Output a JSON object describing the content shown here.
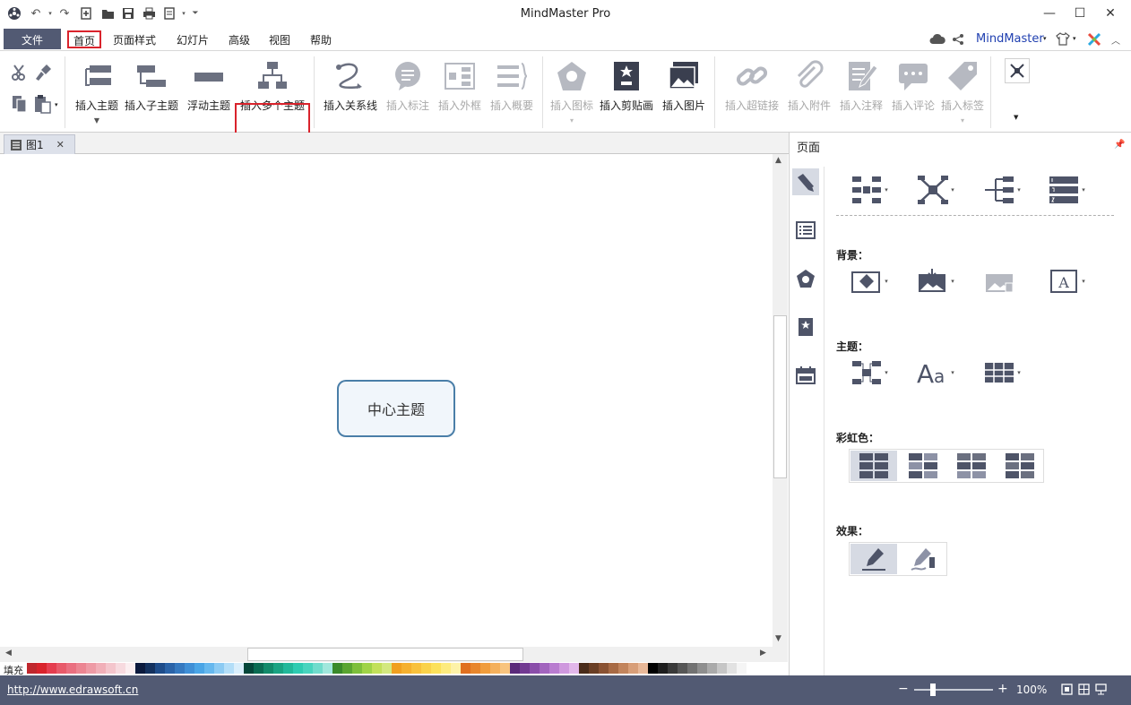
{
  "window": {
    "title": "MindMaster Pro"
  },
  "menu": {
    "file": "文件",
    "items": [
      "首页",
      "页面样式",
      "幻灯片",
      "高级",
      "视图",
      "帮助"
    ],
    "brand": "MindMaster"
  },
  "ribbon": {
    "buttons": [
      {
        "label": "插入主题"
      },
      {
        "label": "插入子主题"
      },
      {
        "label": "浮动主题"
      },
      {
        "label": "插入多个主题"
      },
      {
        "label": "插入关系线"
      },
      {
        "label": "插入标注"
      },
      {
        "label": "插入外框"
      },
      {
        "label": "插入概要"
      },
      {
        "label": "插入图标"
      },
      {
        "label": "插入剪贴画"
      },
      {
        "label": "插入图片"
      },
      {
        "label": "插入超链接"
      },
      {
        "label": "插入附件"
      },
      {
        "label": "插入注释"
      },
      {
        "label": "插入评论"
      },
      {
        "label": "插入标签"
      }
    ]
  },
  "doc_tab": {
    "label": "图1"
  },
  "canvas": {
    "central_topic": "中心主题"
  },
  "colorbar": {
    "label": "填充"
  },
  "status": {
    "url": "http://www.edrawsoft.cn",
    "zoom": "100%"
  },
  "panel": {
    "title": "页面",
    "sections": {
      "background": "背景：",
      "theme": "主题：",
      "rainbow": "彩虹色：",
      "effect": "效果："
    }
  },
  "colors": {
    "accent": "#525a73",
    "highlight": "#d9232c",
    "topic_border": "#4a7ea8",
    "swatches": [
      "#c0272d",
      "#d9232c",
      "#e53d4f",
      "#e85a6a",
      "#ea6f80",
      "#ec8592",
      "#ee9aa5",
      "#f1afb8",
      "#f4c5cc",
      "#f7dadf",
      "#fbeef0",
      "#0c1a3d",
      "#14315e",
      "#1e4c8a",
      "#2a63a8",
      "#3579c0",
      "#3f8fd6",
      "#4aa5e6",
      "#66b8ee",
      "#8ccbf3",
      "#b3def8",
      "#d9eefb",
      "#05473a",
      "#0a6b52",
      "#128a6a",
      "#1aa382",
      "#22b89a",
      "#2ecbb1",
      "#48d4be",
      "#70dccc",
      "#a0e7dc",
      "#3a8a2a",
      "#5aa531",
      "#7dbf3b",
      "#9fd347",
      "#c2e05a",
      "#d3e87f",
      "#f0a020",
      "#f5b02e",
      "#f8c13c",
      "#fad24a",
      "#fce15a",
      "#fdeb7e",
      "#fdf2a8",
      "#e07020",
      "#e8862c",
      "#f09c3c",
      "#f4b05c",
      "#f8c47e",
      "#5a2a7a",
      "#723a92",
      "#8a4eaa",
      "#a264be",
      "#b97cd0",
      "#cf98de",
      "#e2b7ea",
      "#4a2c1a",
      "#6a3e24",
      "#8a5232",
      "#a86a44",
      "#c2845c",
      "#d89e78",
      "#e8b898",
      "#000000",
      "#1e1e1e",
      "#3a3a3a",
      "#565656",
      "#727272",
      "#8e8e8e",
      "#aaaaaa",
      "#c6c6c6",
      "#e2e2e2",
      "#f5f5f5"
    ]
  }
}
